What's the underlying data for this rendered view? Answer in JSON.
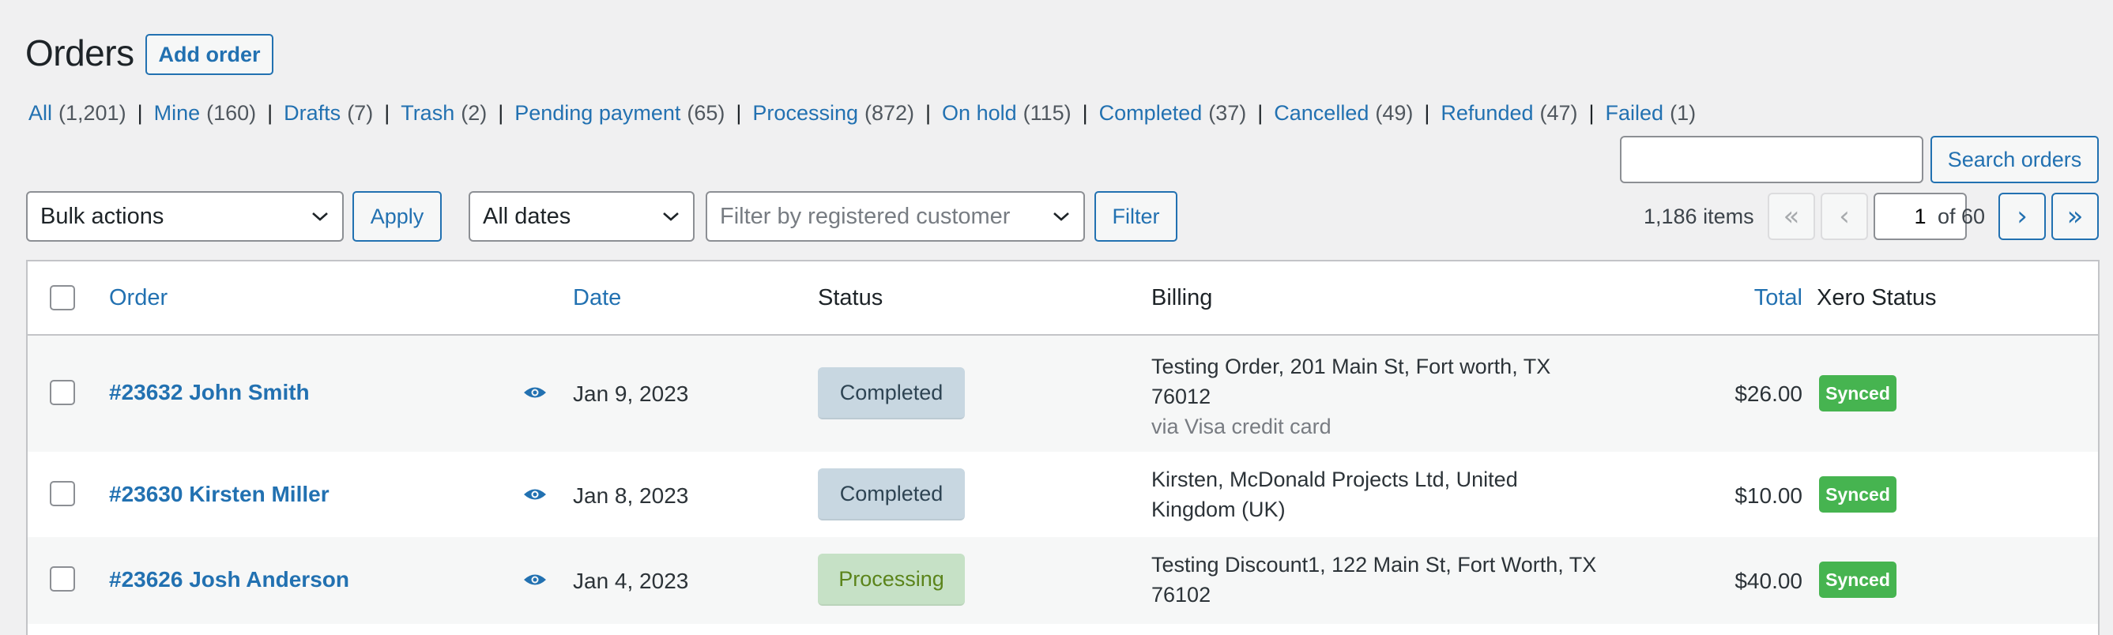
{
  "header": {
    "title": "Orders",
    "add_order_label": "Add order"
  },
  "filters": [
    {
      "label": "All",
      "count": "(1,201)"
    },
    {
      "label": "Mine",
      "count": "(160)"
    },
    {
      "label": "Drafts",
      "count": "(7)"
    },
    {
      "label": "Trash",
      "count": "(2)"
    },
    {
      "label": "Pending payment",
      "count": "(65)"
    },
    {
      "label": "Processing",
      "count": "(872)"
    },
    {
      "label": "On hold",
      "count": "(115)"
    },
    {
      "label": "Completed",
      "count": "(37)"
    },
    {
      "label": "Cancelled",
      "count": "(49)"
    },
    {
      "label": "Refunded",
      "count": "(47)"
    },
    {
      "label": "Failed",
      "count": "(1)"
    }
  ],
  "filter_separator": "|",
  "search": {
    "value": "",
    "button_label": "Search orders"
  },
  "tablenav": {
    "bulk_actions": "Bulk actions",
    "apply_label": "Apply",
    "dates": "All dates",
    "customer_placeholder": "Filter by registered customer",
    "filter_label": "Filter",
    "items_count": "1,186 items",
    "pagination": {
      "first": "«",
      "prev": "‹",
      "current_page": "1",
      "of_total": "of 60",
      "next": "›",
      "last": "»"
    }
  },
  "table": {
    "columns": {
      "order": "Order",
      "date": "Date",
      "status": "Status",
      "billing": "Billing",
      "total": "Total",
      "xero": "Xero Status"
    },
    "rows": [
      {
        "order": "#23632 John Smith",
        "date": "Jan 9, 2023",
        "status": "Completed",
        "billing_line1": "Testing Order, 201 Main St, Fort worth, TX",
        "billing_line2": "76012",
        "billing_via": "via Visa credit card",
        "total": "$26.00",
        "xero": "Synced"
      },
      {
        "order": "#23630 Kirsten Miller",
        "date": "Jan 8, 2023",
        "status": "Completed",
        "billing_line1": "Kirsten, McDonald Projects Ltd, United",
        "billing_line2": "Kingdom (UK)",
        "total": "$10.00",
        "xero": "Synced"
      },
      {
        "order": "#23626 Josh Anderson",
        "date": "Jan 4, 2023",
        "status": "Processing",
        "billing_line1": "Testing Discount1, 122 Main St, Fort Worth, TX",
        "billing_line2": "76102",
        "total": "$40.00",
        "xero": "Synced"
      }
    ]
  },
  "colors": {
    "link": "#2271b1",
    "completed_bg": "#c8d7e1",
    "completed_text": "#2e4453",
    "processing_bg": "#c6e1c6",
    "processing_text": "#5b841b",
    "synced_bg": "#46b450"
  }
}
